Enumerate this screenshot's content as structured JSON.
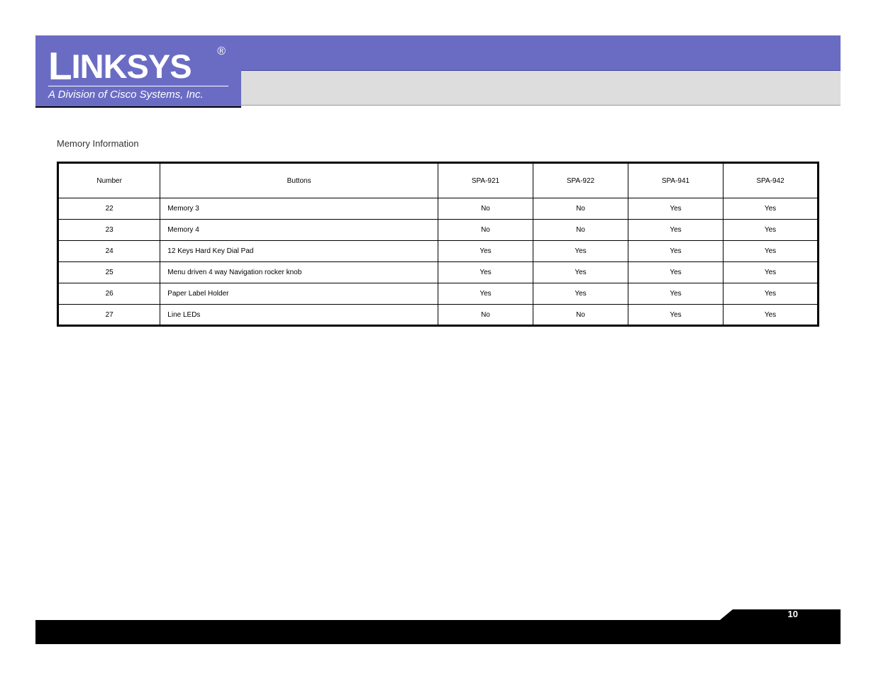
{
  "logo": {
    "brand": "LINKSYS",
    "registered": "®",
    "subtitle": "A Division of Cisco Systems, Inc."
  },
  "section_title": "Memory Information",
  "table": {
    "headers": {
      "number": "Number",
      "buttons": "Buttons",
      "spa921": "SPA-921",
      "spa922": "SPA-922",
      "spa941": "SPA-941",
      "spa942": "SPA-942"
    },
    "rows": [
      {
        "number": "22",
        "label": "Memory 3",
        "spa921": "No",
        "spa922": "No",
        "spa941": "Yes",
        "spa942": "Yes"
      },
      {
        "number": "23",
        "label": "Memory 4",
        "spa921": "No",
        "spa922": "No",
        "spa941": "Yes",
        "spa942": "Yes"
      },
      {
        "number": "24",
        "label": "12 Keys Hard Key Dial Pad",
        "spa921": "Yes",
        "spa922": "Yes",
        "spa941": "Yes",
        "spa942": "Yes"
      },
      {
        "number": "25",
        "label": "Menu driven 4 way Navigation rocker knob",
        "spa921": "Yes",
        "spa922": "Yes",
        "spa941": "Yes",
        "spa942": "Yes"
      },
      {
        "number": "26",
        "label": "Paper Label Holder",
        "spa921": "Yes",
        "spa922": "Yes",
        "spa941": "Yes",
        "spa942": "Yes"
      },
      {
        "number": "27",
        "label": "Line LEDs",
        "spa921": "No",
        "spa922": "No",
        "spa941": "Yes",
        "spa942": "Yes"
      }
    ]
  },
  "page_number": "10"
}
